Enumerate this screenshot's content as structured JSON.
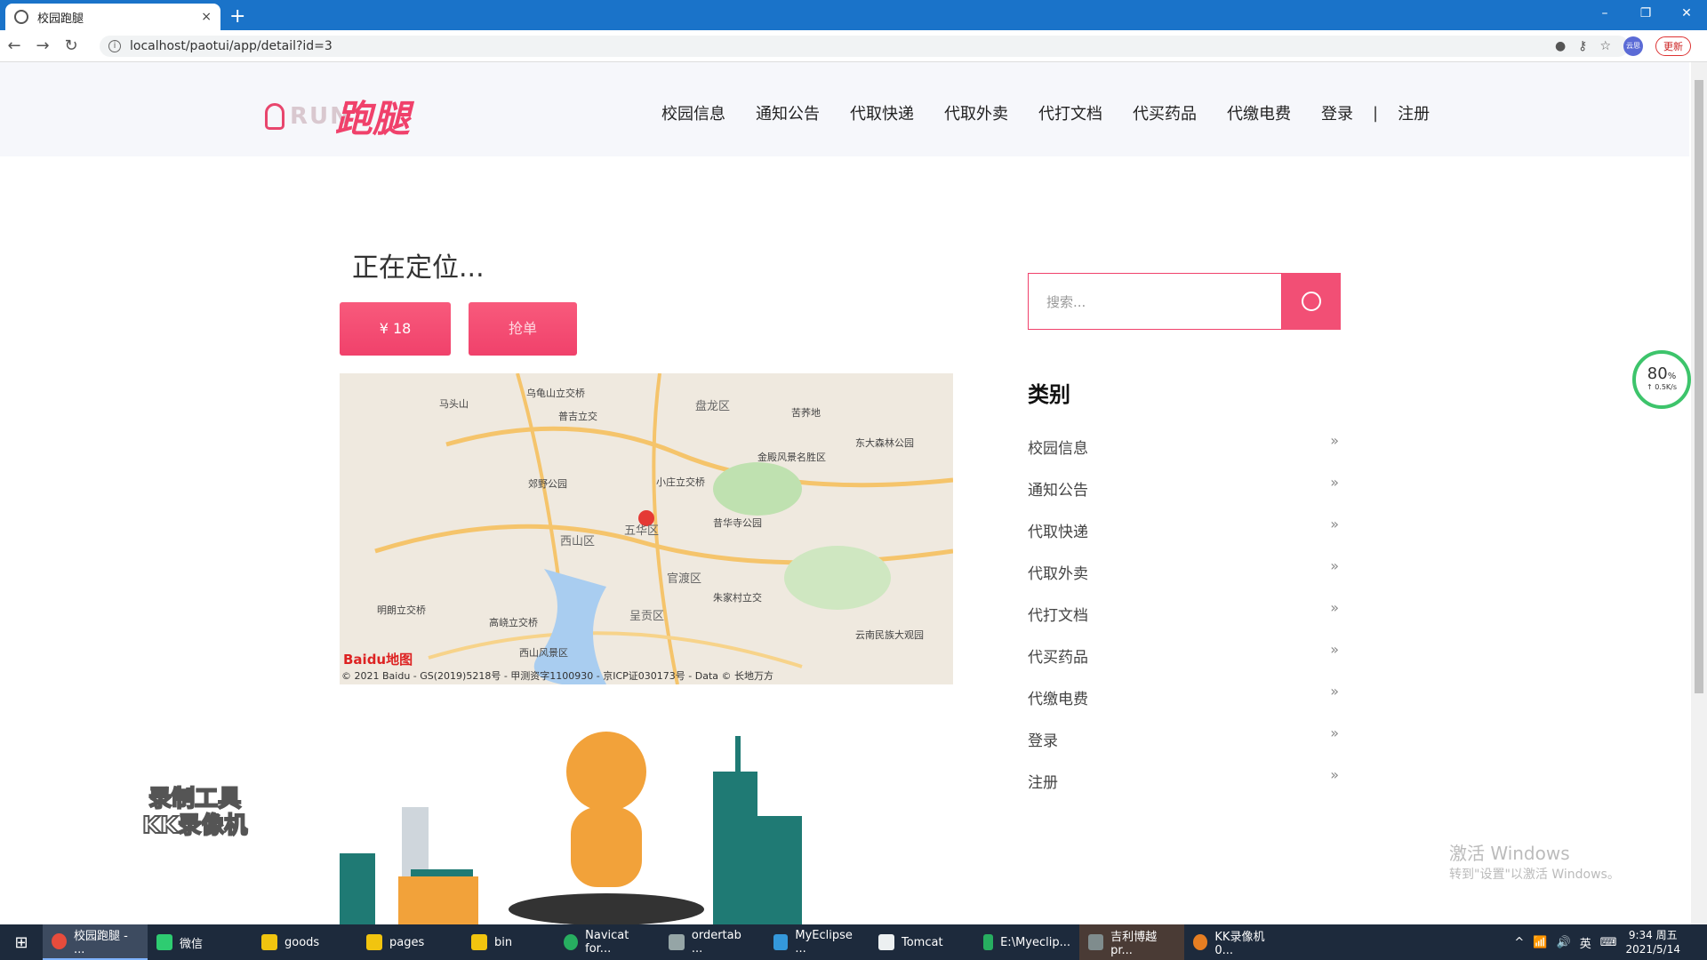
{
  "browser": {
    "tab_title": "校园跑腿",
    "tab_close": "×",
    "new_tab": "+",
    "url": "localhost/paotui/app/detail?id=3",
    "update_label": "更新",
    "avatar_text": "云思",
    "window_controls": [
      "–",
      "❐",
      "✕"
    ]
  },
  "site": {
    "logo_latin": "RUN",
    "logo_cn": "跑腿",
    "nav": [
      "校园信息",
      "通知公告",
      "代取快递",
      "代取外卖",
      "代打文档",
      "代买药品",
      "代缴电费",
      "登录"
    ],
    "nav_sep": "|",
    "nav_register": "注册"
  },
  "main": {
    "status_title": "正在定位...",
    "price_button": "¥ 18",
    "grab_button": "抢单",
    "map_copyright": "© 2021 Baidu - GS(2019)5218号 - 甲测资字1100930 - 京ICP证030173号 - Data © 长地万方",
    "map_logo": "Baidu地图",
    "map_labels": [
      "马头山",
      "乌龟山立交桥",
      "普吉立交",
      "盘龙区",
      "苦荞地",
      "东大森林公园",
      "小庄立交桥",
      "金殿风景名胜区",
      "郊野公园",
      "昔华寺公园",
      "西山区",
      "五华区",
      "官渡区",
      "朱家村立交",
      "云南民族大观园",
      "明朗立交桥",
      "高峣立交桥",
      "西山风景区",
      "呈贡区"
    ],
    "kk_watermark": [
      "录制工具",
      "KK录像机"
    ]
  },
  "sidebar": {
    "search_placeholder": "搜索...",
    "category_title": "类别",
    "categories": [
      "校园信息",
      "通知公告",
      "代取快递",
      "代取外卖",
      "代打文档",
      "代买药品",
      "代缴电费",
      "登录",
      "注册"
    ],
    "chevron": "»"
  },
  "overlay": {
    "speed_pct": "80",
    "speed_unit": "%",
    "speed_rate": "↑ 0.5K/s",
    "activate_line1": "激活 Windows",
    "activate_line2": "转到\"设置\"以激活 Windows。"
  },
  "taskbar": {
    "items": [
      "校园跑腿 - ...",
      "微信",
      "goods",
      "pages",
      "bin",
      "Navicat for...",
      "ordertab ...",
      "MyEclipse ...",
      "Tomcat",
      "E:\\Myeclip...",
      "吉利博越pr...",
      "KK录像机 0..."
    ],
    "item_colors": [
      "#e74c3c",
      "#2ecc71",
      "#f1c40f",
      "#f1c40f",
      "#f1c40f",
      "#27ae60",
      "#95a5a6",
      "#3498db",
      "#ecf0f1",
      "#27ae60",
      "#7f8c8d",
      "#e67e22"
    ],
    "ime": "英",
    "time": "9:34 周五",
    "date": "2021/5/14"
  }
}
